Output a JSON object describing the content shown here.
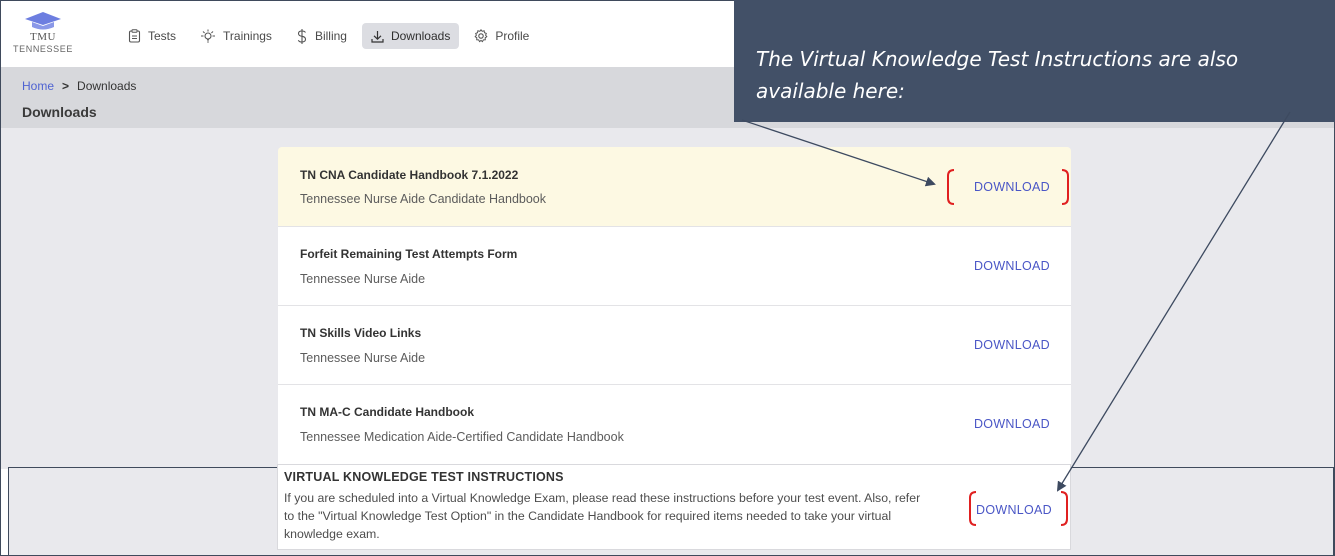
{
  "brand": {
    "name": "TMU",
    "state": "TENNESSEE"
  },
  "nav": [
    {
      "label": "Tests",
      "icon": "clipboard-icon",
      "active": false
    },
    {
      "label": "Trainings",
      "icon": "lightbulb-icon",
      "active": false
    },
    {
      "label": "Billing",
      "icon": "dollar-icon",
      "active": false
    },
    {
      "label": "Downloads",
      "icon": "download-icon",
      "active": true
    },
    {
      "label": "Profile",
      "icon": "gear-icon",
      "active": false
    }
  ],
  "breadcrumb": {
    "home": "Home",
    "separator": ">",
    "current": "Downloads"
  },
  "page_title": "Downloads",
  "downloads": [
    {
      "title": "TN CNA Candidate Handbook 7.1.2022",
      "subtitle": "Tennessee Nurse Aide Candidate Handbook",
      "action": "DOWNLOAD",
      "highlighted": true
    },
    {
      "title": "Forfeit Remaining Test Attempts Form",
      "subtitle": "Tennessee Nurse Aide",
      "action": "DOWNLOAD",
      "highlighted": false
    },
    {
      "title": "TN Skills Video Links",
      "subtitle": "Tennessee Nurse Aide",
      "action": "DOWNLOAD",
      "highlighted": false
    },
    {
      "title": "TN MA-C Candidate Handbook",
      "subtitle": "Tennessee Medication Aide-Certified Candidate Handbook",
      "action": "DOWNLOAD",
      "highlighted": false
    }
  ],
  "virtual_instructions": {
    "title": "VIRTUAL KNOWLEDGE TEST INSTRUCTIONS",
    "body": "If you are scheduled into a Virtual Knowledge Exam, please read these instructions before your test event. Also, refer to the \"Virtual Knowledge Test Option\" in the Candidate Handbook for required items needed to take your virtual knowledge exam.",
    "action": "DOWNLOAD"
  },
  "callout": {
    "text": "The Virtual Knowledge Test Instructions are also available here:"
  },
  "colors": {
    "accent": "#4a56c6",
    "link": "#4f63d2",
    "callout_bg": "#425067",
    "highlight_row": "#fdf9e3",
    "bracket": "#e02020",
    "nav_active_bg": "#dcdde2"
  }
}
